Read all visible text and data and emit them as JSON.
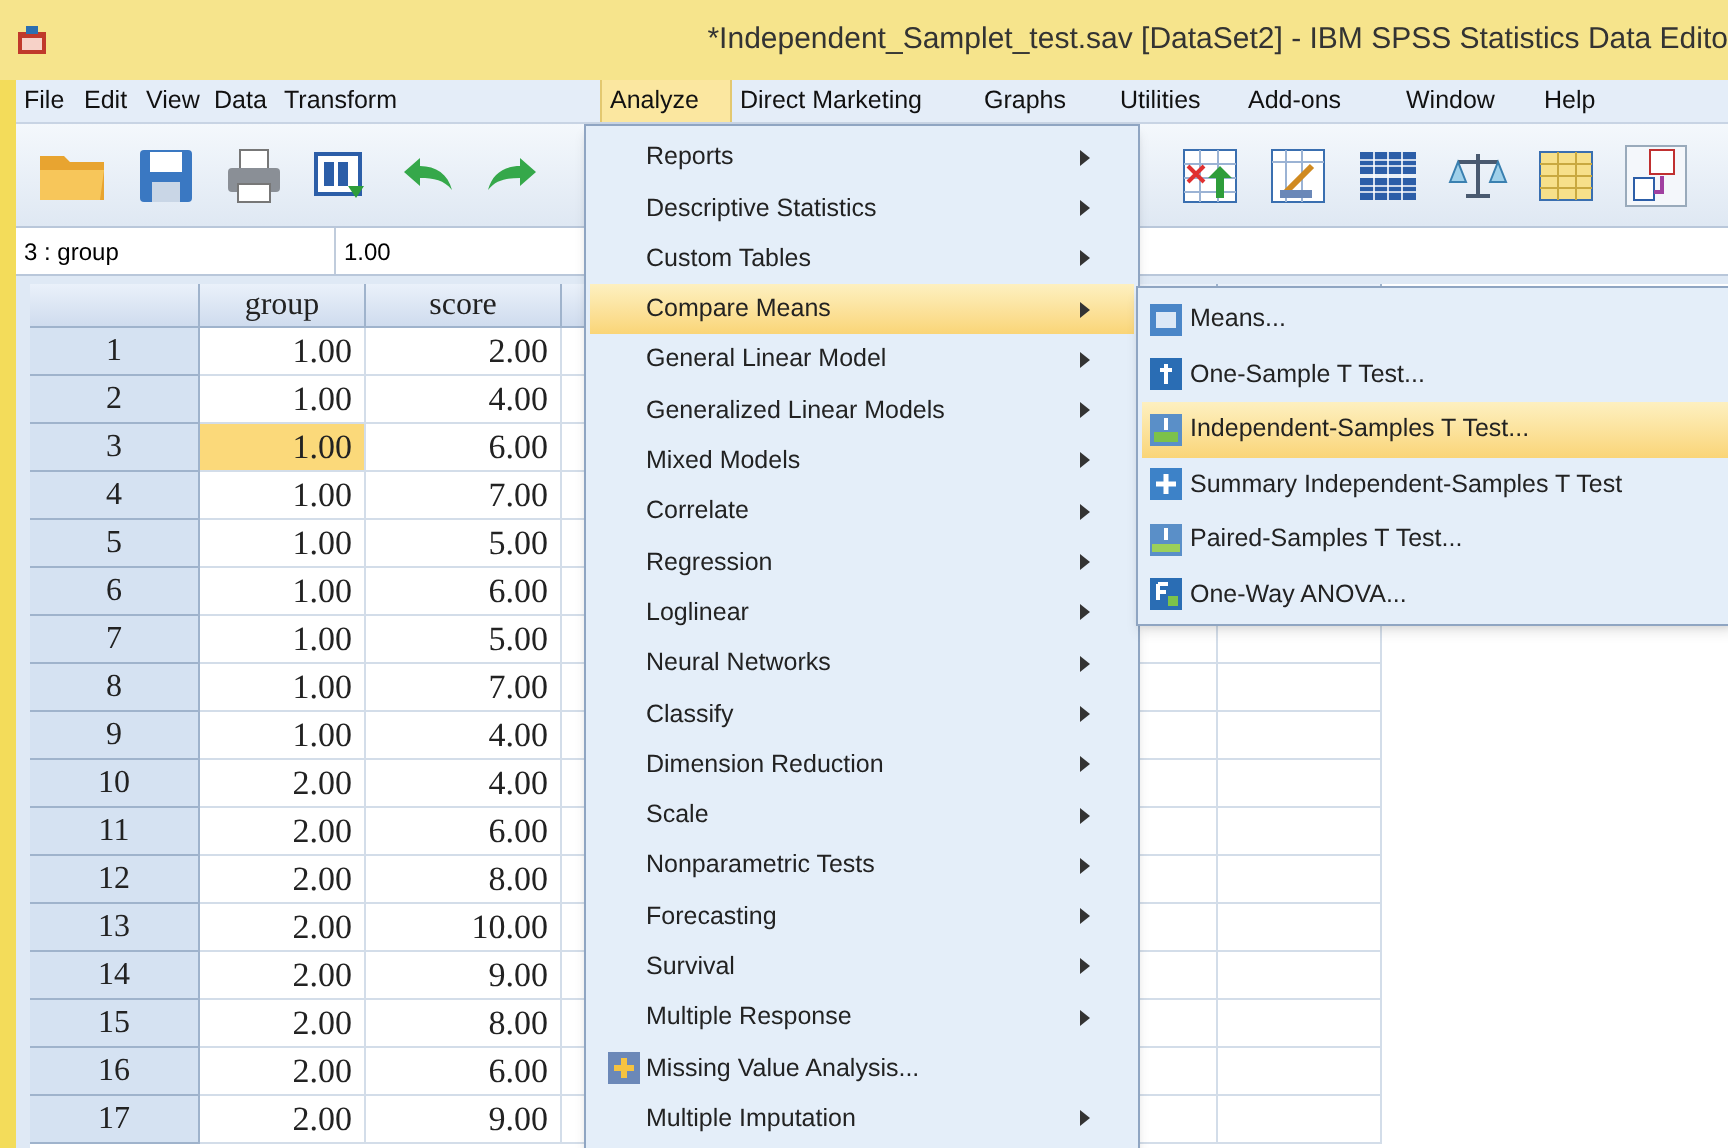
{
  "window": {
    "title": "*Independent_Samplet_test.sav [DataSet2] - IBM SPSS Statistics Data Edito"
  },
  "menu_bar": [
    {
      "label": "File",
      "selected": false
    },
    {
      "label": "Edit",
      "selected": false
    },
    {
      "label": "View",
      "selected": false
    },
    {
      "label": "Data",
      "selected": false
    },
    {
      "label": "Transform",
      "selected": false
    },
    {
      "label": "Analyze",
      "selected": true
    },
    {
      "label": "Direct Marketing",
      "selected": false
    },
    {
      "label": "Graphs",
      "selected": false
    },
    {
      "label": "Utilities",
      "selected": false
    },
    {
      "label": "Add-ons",
      "selected": false
    },
    {
      "label": "Window",
      "selected": false
    },
    {
      "label": "Help",
      "selected": false
    }
  ],
  "cell_editor": {
    "cell": "3 : group",
    "value": "1.00"
  },
  "grid": {
    "columns": [
      "group",
      "score"
    ],
    "rows": [
      {
        "label": "1",
        "cells": [
          {
            "text": "1.00",
            "selected": false
          },
          {
            "text": "2.00",
            "selected": false
          }
        ]
      },
      {
        "label": "2",
        "cells": [
          {
            "text": "1.00",
            "selected": false
          },
          {
            "text": "4.00",
            "selected": false
          }
        ]
      },
      {
        "label": "3",
        "cells": [
          {
            "text": "1.00",
            "selected": true
          },
          {
            "text": "6.00",
            "selected": false
          }
        ]
      },
      {
        "label": "4",
        "cells": [
          {
            "text": "1.00",
            "selected": false
          },
          {
            "text": "7.00",
            "selected": false
          }
        ]
      },
      {
        "label": "5",
        "cells": [
          {
            "text": "1.00",
            "selected": false
          },
          {
            "text": "5.00",
            "selected": false
          }
        ]
      },
      {
        "label": "6",
        "cells": [
          {
            "text": "1.00",
            "selected": false
          },
          {
            "text": "6.00",
            "selected": false
          }
        ]
      },
      {
        "label": "7",
        "cells": [
          {
            "text": "1.00",
            "selected": false
          },
          {
            "text": "5.00",
            "selected": false
          }
        ]
      },
      {
        "label": "8",
        "cells": [
          {
            "text": "1.00",
            "selected": false
          },
          {
            "text": "7.00",
            "selected": false
          }
        ]
      },
      {
        "label": "9",
        "cells": [
          {
            "text": "1.00",
            "selected": false
          },
          {
            "text": "4.00",
            "selected": false
          }
        ]
      },
      {
        "label": "10",
        "cells": [
          {
            "text": "2.00",
            "selected": false
          },
          {
            "text": "4.00",
            "selected": false
          }
        ]
      },
      {
        "label": "11",
        "cells": [
          {
            "text": "2.00",
            "selected": false
          },
          {
            "text": "6.00",
            "selected": false
          }
        ]
      },
      {
        "label": "12",
        "cells": [
          {
            "text": "2.00",
            "selected": false
          },
          {
            "text": "8.00",
            "selected": false
          }
        ]
      },
      {
        "label": "13",
        "cells": [
          {
            "text": "2.00",
            "selected": false
          },
          {
            "text": "10.00",
            "selected": false
          }
        ]
      },
      {
        "label": "14",
        "cells": [
          {
            "text": "2.00",
            "selected": false
          },
          {
            "text": "9.00",
            "selected": false
          }
        ]
      },
      {
        "label": "15",
        "cells": [
          {
            "text": "2.00",
            "selected": false
          },
          {
            "text": "8.00",
            "selected": false
          }
        ]
      },
      {
        "label": "16",
        "cells": [
          {
            "text": "2.00",
            "selected": false
          },
          {
            "text": "6.00",
            "selected": false
          }
        ]
      },
      {
        "label": "17",
        "cells": [
          {
            "text": "2.00",
            "selected": false
          },
          {
            "text": "9.00",
            "selected": false
          }
        ]
      }
    ]
  },
  "analyze_menu": [
    {
      "label": "Reports",
      "kind": "submenu",
      "selected": false
    },
    {
      "label": "Descriptive Statistics",
      "kind": "submenu",
      "selected": false
    },
    {
      "label": "Custom Tables",
      "kind": "submenu",
      "selected": false
    },
    {
      "label": "Compare Means",
      "kind": "submenu",
      "selected": true
    },
    {
      "label": "General Linear Model",
      "kind": "submenu",
      "selected": false
    },
    {
      "label": "Generalized Linear Models",
      "kind": "submenu",
      "selected": false
    },
    {
      "label": "Mixed Models",
      "kind": "submenu",
      "selected": false
    },
    {
      "label": "Correlate",
      "kind": "submenu",
      "selected": false
    },
    {
      "label": "Regression",
      "kind": "submenu",
      "selected": false
    },
    {
      "label": "Loglinear",
      "kind": "submenu",
      "selected": false
    },
    {
      "label": "Neural Networks",
      "kind": "submenu",
      "selected": false
    },
    {
      "label": "Classify",
      "kind": "submenu",
      "selected": false
    },
    {
      "label": "Dimension Reduction",
      "kind": "submenu",
      "selected": false
    },
    {
      "label": "Scale",
      "kind": "submenu",
      "selected": false
    },
    {
      "label": "Nonparametric Tests",
      "kind": "submenu",
      "selected": false
    },
    {
      "label": "Forecasting",
      "kind": "submenu",
      "selected": false
    },
    {
      "label": "Survival",
      "kind": "submenu",
      "selected": false
    },
    {
      "label": "Multiple Response",
      "kind": "submenu",
      "selected": false
    },
    {
      "label": "Missing Value Analysis...",
      "kind": "command",
      "selected": false
    },
    {
      "label": "Multiple Imputation",
      "kind": "submenu",
      "selected": false
    }
  ],
  "compare_means_menu": [
    {
      "label": "Means...",
      "selected": false
    },
    {
      "label": "One-Sample T Test...",
      "selected": false
    },
    {
      "label": "Independent-Samples T Test...",
      "selected": true
    },
    {
      "label": "Summary Independent-Samples T Test",
      "selected": false
    },
    {
      "label": "Paired-Samples T Test...",
      "selected": false
    },
    {
      "label": "One-Way ANOVA...",
      "selected": false
    }
  ]
}
